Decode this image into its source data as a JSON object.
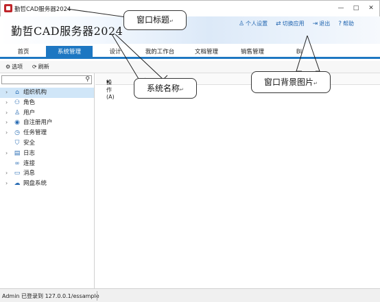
{
  "window": {
    "title": "勤哲CAD服务器2024",
    "minimize_icon": "minimize-icon",
    "maximize_icon": "maximize-icon",
    "close_icon": "close-icon"
  },
  "header": {
    "system_name": "勤哲CAD服务器2024",
    "links": [
      {
        "label": "个人设置",
        "icon": "user-icon",
        "glyph": "♙"
      },
      {
        "label": "切换应用",
        "icon": "switch-icon",
        "glyph": "⇄"
      },
      {
        "label": "退出",
        "icon": "logout-icon",
        "glyph": "⇥"
      },
      {
        "label": "帮助",
        "icon": "help-icon",
        "glyph": "?"
      }
    ]
  },
  "tabs": [
    {
      "label": "首页",
      "active": false
    },
    {
      "label": "系统管理",
      "active": true
    },
    {
      "label": "设计",
      "active": false
    },
    {
      "label": "我的工作台",
      "active": false
    },
    {
      "label": "文档管理",
      "active": false
    },
    {
      "label": "销售管理",
      "active": false
    },
    {
      "label": "BI",
      "active": false
    }
  ],
  "toolbar": {
    "options_label": "选项",
    "refresh_label": "刷新"
  },
  "sidebar": {
    "search_value": "",
    "tree": [
      {
        "label": "组织机构",
        "icon": "org-icon",
        "glyph": "⌂",
        "expandable": true,
        "selected": true
      },
      {
        "label": "角色",
        "icon": "role-icon",
        "glyph": "⚇",
        "expandable": true,
        "selected": false
      },
      {
        "label": "用户",
        "icon": "user-icon",
        "glyph": "♙",
        "expandable": true,
        "selected": false
      },
      {
        "label": "自注册用户",
        "icon": "self-register-icon",
        "glyph": "◉",
        "expandable": true,
        "selected": false
      },
      {
        "label": "任务管理",
        "icon": "clock-icon",
        "glyph": "◷",
        "expandable": true,
        "selected": false
      },
      {
        "label": "安全",
        "icon": "shield-icon",
        "glyph": "⛉",
        "expandable": false,
        "selected": false
      },
      {
        "label": "日志",
        "icon": "log-icon",
        "glyph": "▤",
        "expandable": true,
        "selected": false
      },
      {
        "label": "连接",
        "icon": "link-icon",
        "glyph": "∞",
        "expandable": false,
        "selected": false
      },
      {
        "label": "消息",
        "icon": "message-icon",
        "glyph": "▭",
        "expandable": true,
        "selected": false
      },
      {
        "label": "网盘系统",
        "icon": "cloud-icon",
        "glyph": "☁",
        "expandable": true,
        "selected": false
      }
    ]
  },
  "content": {
    "operations_label": "操作(A)"
  },
  "status": {
    "text": "Admin 已登录到 127.0.0.1/essample"
  },
  "annotations": {
    "window_title": "窗口标题",
    "system_name": "系统名称",
    "window_background": "窗口背景图片"
  },
  "colors": {
    "accent": "#1d77c2",
    "link": "#2266b0",
    "selected_row": "#d0e6f8"
  }
}
